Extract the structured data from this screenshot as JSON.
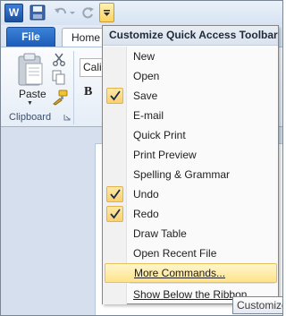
{
  "titlebar": {
    "app_icon_letter": "W"
  },
  "tabs": {
    "file": "File",
    "home": "Home"
  },
  "ribbon": {
    "paste_label": "Paste",
    "clipboard_group_label": "Clipboard",
    "font_name": "Calib",
    "bold_label": "B"
  },
  "menu": {
    "header": "Customize Quick Access Toolbar",
    "items": [
      {
        "label": "New",
        "checked": false
      },
      {
        "label": "Open",
        "checked": false
      },
      {
        "label": "Save",
        "checked": true
      },
      {
        "label": "E-mail",
        "checked": false
      },
      {
        "label": "Quick Print",
        "checked": false
      },
      {
        "label": "Print Preview",
        "checked": false
      },
      {
        "label": "Spelling & Grammar",
        "checked": false
      },
      {
        "label": "Undo",
        "checked": true
      },
      {
        "label": "Redo",
        "checked": true
      },
      {
        "label": "Draw Table",
        "checked": false
      },
      {
        "label": "Open Recent File",
        "checked": false
      }
    ],
    "more_commands": "More Commands...",
    "show_below": "Show Below the Ribbon"
  },
  "tooltip": {
    "text": "Customize"
  },
  "colors": {
    "file_tab": "#1b5bb8",
    "highlight": "#ffe38a",
    "check_bg": "#fbd06f"
  }
}
